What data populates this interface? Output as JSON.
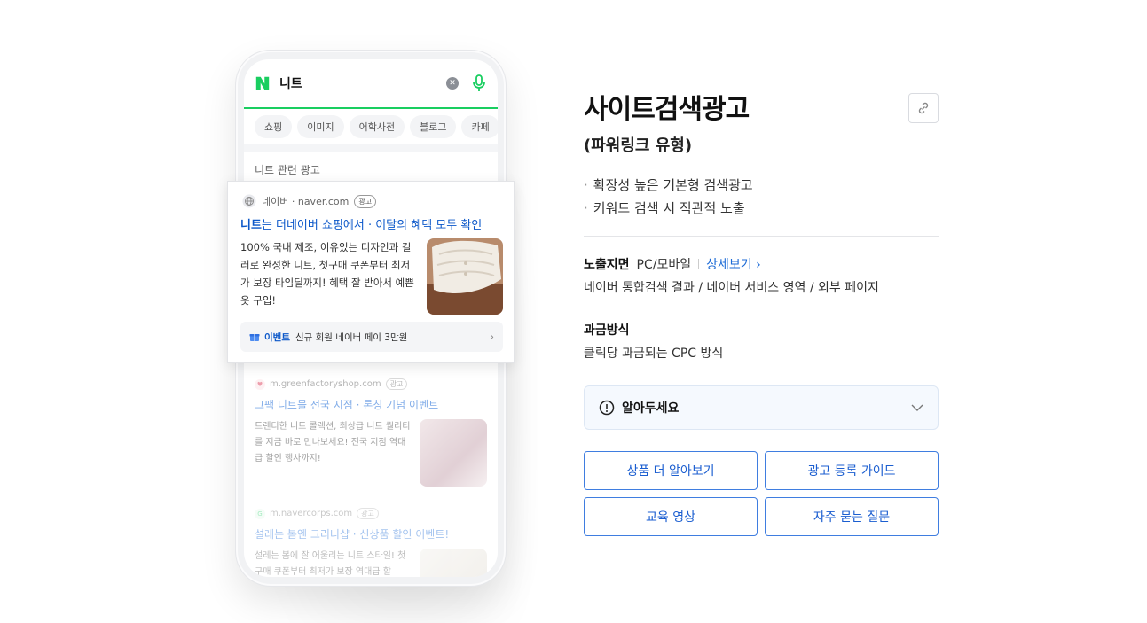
{
  "phone": {
    "search_query": "니트",
    "tabs": [
      "쇼핑",
      "이미지",
      "어학사전",
      "블로그",
      "카페"
    ],
    "ad_header": "니트 관련 광고",
    "ad_card": {
      "site": "네이버 · naver.com",
      "badge": "광고",
      "title_keyword": "니트",
      "title_rest": "는 더네이버 쇼핑에서 · 이달의 혜택 모두 확인",
      "description": "100% 국내 제조, 이유있는 디자인과 컬러로 완성한 니트, 첫구매 쿠폰부터 최저가 보장 타임딜까지! 혜택 잘 받아서 예쁜 옷 구입!",
      "event_label": "이벤트",
      "event_text": "신규 회원 네이버 페이 3만원"
    },
    "ad2": {
      "site": "m.greenfactoryshop.com",
      "badge": "광고",
      "title": "그팩 니트몰 전국 지점 · 론칭 기념 이벤트",
      "description": "트렌디한 니트 콜렉션, 최상급 니트 퀄리티를 지금 바로 만나보세요! 전국 지점 역대급 할인 행사까지!"
    },
    "ad3": {
      "site": "m.navercorps.com",
      "badge": "광고",
      "title": "설레는 봄엔 그리니샵 · 신상품 할인 이벤트!",
      "description": "설레는 봄에 잘 어울리는 니트 스타일! 첫 구매 쿠폰부터 최저가 보장 역대급 할"
    }
  },
  "info": {
    "title": "사이트검색광고",
    "subtitle": "(파워링크 유형)",
    "bullets": [
      "확장성 높은 기본형 검색광고",
      "키워드 검색 시 직관적 노출"
    ],
    "exposure_label": "노출지면",
    "exposure_value": "PC/모바일",
    "detail_link": "상세보기 ›",
    "exposure_desc": "네이버 통합검색 결과 / 네이버 서비스 영역 / 외부 페이지",
    "billing_label": "과금방식",
    "billing_desc": "클릭당 과금되는 CPC 방식",
    "notice": "알아두세요",
    "buttons": [
      "상품 더 알아보기",
      "광고 등록 가이드",
      "교육 영상",
      "자주 묻는 질문"
    ]
  },
  "colors": {
    "naver_green": "#19ce60",
    "link_blue": "#1b6ad6",
    "button_border": "#3f7de0"
  }
}
